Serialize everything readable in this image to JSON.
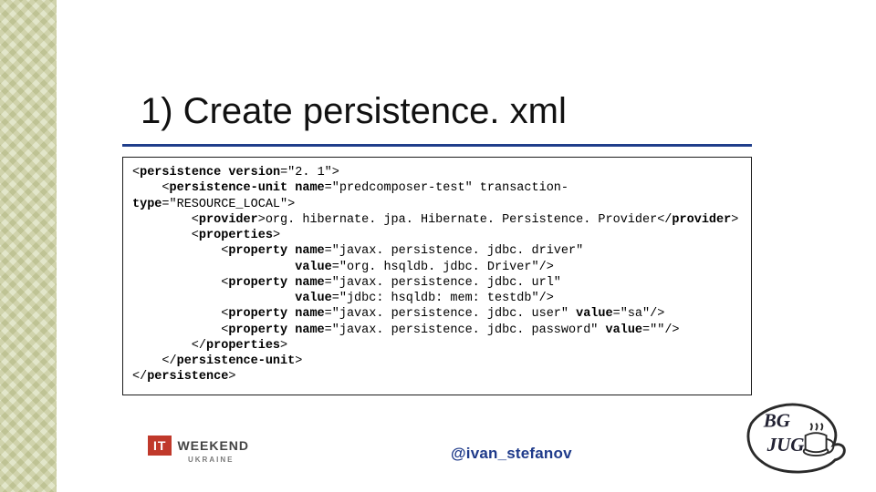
{
  "title": "1) Create persistence. xml",
  "code_lines": [
    "<persistence version=\"2. 1\">",
    "    <persistence-unit name=\"predcomposer-test\" transaction-",
    "type=\"RESOURCE_LOCAL\">",
    "        <provider>org. hibernate. jpa. Hibernate. Persistence. Provider</provider>",
    "        <properties>",
    "            <property name=\"javax. persistence. jdbc. driver\"",
    "                      value=\"org. hsqldb. jdbc. Driver\"/>",
    "            <property name=\"javax. persistence. jdbc. url\"",
    "                      value=\"jdbc: hsqldb: mem: testdb\"/>",
    "            <property name=\"javax. persistence. jdbc. user\" value=\"sa\"/>",
    "            <property name=\"javax. persistence. jdbc. password\" value=\"\"/>",
    "        </properties>",
    "    </persistence-unit>",
    "</persistence>"
  ],
  "footer": {
    "handle": "@ivan_stefanov",
    "logo_left": {
      "badge": "IT",
      "word": "WEEKEND",
      "sub": "UKRAINE"
    },
    "logo_right": {
      "text_top": "BG",
      "text_bottom": "JUG"
    }
  }
}
